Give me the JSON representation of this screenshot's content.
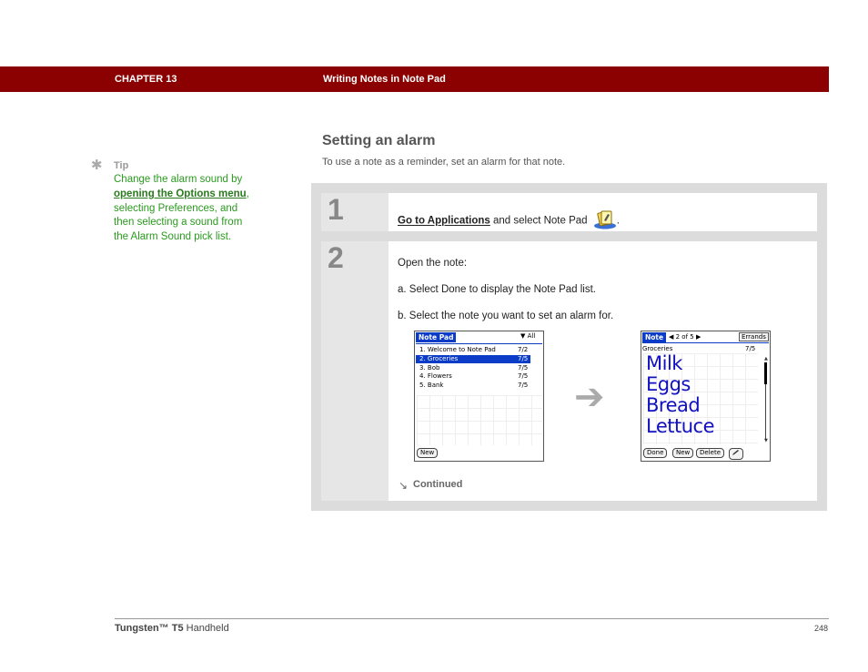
{
  "header": {
    "chapter": "CHAPTER 13",
    "title": "Writing Notes in Note Pad"
  },
  "tip": {
    "label": "Tip",
    "text_1": "Change the alarm sound by ",
    "link": "opening the Options menu",
    "text_2": ", selecting Preferences, and then selecting a sound from the Alarm Sound pick list."
  },
  "section": {
    "title": "Setting an alarm",
    "intro": "To use a note as a reminder, set an alarm for that note."
  },
  "steps": [
    {
      "number": "1",
      "link": "Go to Applications",
      "text": " and select Note Pad",
      "end": "."
    },
    {
      "number": "2",
      "lines": [
        "Open the note:",
        "a.  Select Done to display the Note Pad list.",
        "b.  Select the note you want to set an alarm for."
      ]
    }
  ],
  "screen_list": {
    "title": "Note Pad",
    "category": "All",
    "items": [
      {
        "label": "1. Welcome to Note Pad",
        "date": "7/2"
      },
      {
        "label": "2. Groceries",
        "date": "7/5"
      },
      {
        "label": "3. Bob",
        "date": "7/5"
      },
      {
        "label": "4. Flowers",
        "date": "7/5"
      },
      {
        "label": "5. Bank",
        "date": "7/5"
      }
    ],
    "selected_index": 1,
    "new_button": "New"
  },
  "screen_note": {
    "title": "Note",
    "pager": "2 of 5",
    "category": "Errands",
    "note_title": "Groceries",
    "note_date": "7/5",
    "handwriting": [
      "Milk",
      "Eggs",
      "Bread",
      "Lettuce"
    ],
    "buttons": [
      "Done",
      "New",
      "Delete"
    ]
  },
  "continued": "Continued",
  "footer": {
    "brand": "Tungsten™ T5",
    "product": " Handheld",
    "page": "248"
  },
  "colors": {
    "header_bg": "#8b0000",
    "tip_green": "#2a9a1e",
    "palm_blue": "#0a3cc8",
    "ink": "#1010c0"
  },
  "icons": [
    "tip-star-icon",
    "note-pad-app-icon",
    "right-arrow-icon",
    "continued-arrow-icon",
    "pen-icon"
  ]
}
